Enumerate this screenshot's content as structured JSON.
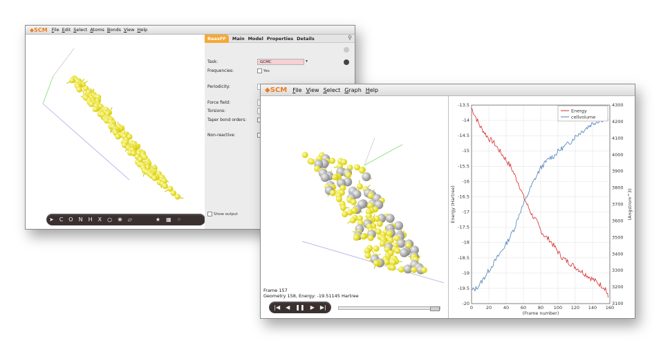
{
  "window1": {
    "logo": "SCM",
    "menu": [
      "File",
      "Edit",
      "Select",
      "Atoms",
      "Bonds",
      "View",
      "Help"
    ],
    "tabs": [
      "ReaxFF",
      "Main",
      "Model",
      "Properties",
      "Details"
    ],
    "task_label": "Task:",
    "task_value": "GCMC",
    "frequencies_label": "Frequencies:",
    "frequencies_option": "Yes",
    "periodicity_label": "Periodicity:",
    "periodicity_value": "Bu",
    "forcefield_label": "Force field:",
    "forcefield_value": "",
    "torsions_label": "Torsions:",
    "torsions_value": "Or",
    "taper_label": "Taper bond orders:",
    "taper_option": "Ye",
    "nonreactive_label": "Non-reactive:",
    "nonreactive_option": "Ye",
    "show_output": "Show output",
    "toolbar": [
      "C",
      "O",
      "N",
      "H",
      "X"
    ]
  },
  "window2": {
    "logo": "SCM",
    "menu": [
      "File",
      "View",
      "Select",
      "Graph",
      "Help"
    ],
    "frame_label": "Frame 157",
    "geometry_label": "Geometry 158, Energy: -19.51145 Hartree",
    "playback": [
      "first-frame",
      "prev-frame",
      "pause",
      "next-frame",
      "last-frame"
    ]
  },
  "chart_data": {
    "type": "line",
    "xlabel": "(Frame number)",
    "ylabel": "Energy (Hartree)",
    "y2label": "(Angstrom^3)",
    "xlim": [
      0,
      160
    ],
    "ylim": [
      -20,
      -13.5
    ],
    "y2lim": [
      3100,
      4300
    ],
    "x_ticks": [
      0,
      20,
      40,
      60,
      80,
      100,
      120,
      140,
      160
    ],
    "y_ticks": [
      -13.5,
      -14,
      -14.5,
      -15,
      -15.5,
      -16,
      -16.5,
      -17,
      -17.5,
      -18,
      -18.5,
      -19,
      -19.5,
      -20
    ],
    "y2_ticks": [
      3100,
      3200,
      3300,
      3400,
      3500,
      3600,
      3700,
      3800,
      3900,
      4000,
      4100,
      4200,
      4300
    ],
    "legend_position": "top-right",
    "grid": true,
    "series": [
      {
        "name": "Energy",
        "color": "#d62728",
        "axis": "left",
        "x": [
          0,
          5,
          10,
          15,
          20,
          25,
          30,
          35,
          40,
          45,
          50,
          55,
          60,
          65,
          70,
          75,
          80,
          85,
          90,
          95,
          100,
          105,
          110,
          115,
          120,
          125,
          130,
          135,
          140,
          145,
          150,
          155,
          158
        ],
        "y": [
          -13.6,
          -13.9,
          -14.2,
          -14.4,
          -14.6,
          -14.7,
          -14.9,
          -15.1,
          -15.3,
          -15.5,
          -15.8,
          -16.1,
          -16.5,
          -16.8,
          -17.1,
          -17.3,
          -17.6,
          -17.8,
          -17.9,
          -18.1,
          -18.3,
          -18.5,
          -18.6,
          -18.7,
          -18.8,
          -18.9,
          -19.0,
          -19.1,
          -19.2,
          -19.3,
          -19.4,
          -19.5,
          -19.8
        ]
      },
      {
        "name": "cellvolume",
        "color": "#4a7eb5",
        "axis": "right",
        "x": [
          0,
          5,
          10,
          15,
          20,
          25,
          30,
          35,
          40,
          45,
          50,
          55,
          60,
          65,
          70,
          75,
          80,
          85,
          90,
          95,
          100,
          105,
          110,
          115,
          120,
          125,
          130,
          135,
          140,
          145,
          150,
          155,
          158
        ],
        "y": [
          3180,
          3190,
          3220,
          3260,
          3300,
          3340,
          3380,
          3420,
          3460,
          3510,
          3560,
          3640,
          3700,
          3760,
          3820,
          3870,
          3920,
          3950,
          3980,
          3990,
          4020,
          4040,
          4060,
          4080,
          4110,
          4130,
          4150,
          4170,
          4190,
          4200,
          4210,
          4220,
          4215
        ]
      }
    ]
  }
}
